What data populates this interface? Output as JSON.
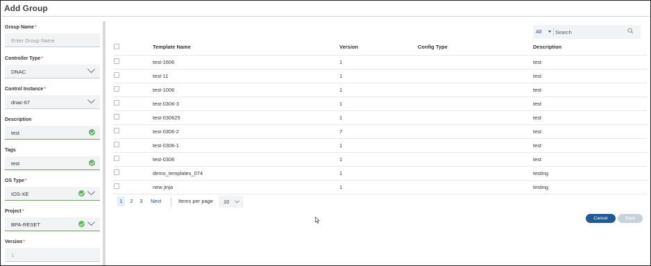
{
  "dialog": {
    "title": "Add Group"
  },
  "form": {
    "fields": [
      {
        "label": "Group Name",
        "required": true,
        "value": "",
        "placeholder": "Enter Group Name",
        "control": "text"
      },
      {
        "label": "Controller Type",
        "required": true,
        "value": "DNAC",
        "control": "select"
      },
      {
        "label": "Control Instance",
        "required": true,
        "value": "dnac-67",
        "control": "select"
      },
      {
        "label": "Description",
        "required": false,
        "value": "test",
        "control": "text",
        "valid": true
      },
      {
        "label": "Tags",
        "required": false,
        "value": "test",
        "control": "text",
        "valid": true
      },
      {
        "label": "OS Type",
        "required": true,
        "value": "IOS-XE",
        "control": "select",
        "valid": true
      },
      {
        "label": "Project",
        "required": true,
        "value": "BPA-RESET",
        "control": "select",
        "valid": true
      },
      {
        "label": "Version",
        "required": true,
        "value": "1",
        "control": "text",
        "disabled": true
      }
    ]
  },
  "filter": {
    "scope": "All",
    "search_placeholder": "Search",
    "search_value": ""
  },
  "table": {
    "columns": [
      "Template Name",
      "Version",
      "Config Type",
      "Description"
    ],
    "rows": [
      {
        "name": "test-1606",
        "version": "1",
        "config_type": "",
        "description": "test"
      },
      {
        "name": "test-11",
        "version": "1",
        "config_type": "",
        "description": "test"
      },
      {
        "name": "test-1006",
        "version": "1",
        "config_type": "",
        "description": "test"
      },
      {
        "name": "test-0306-3",
        "version": "1",
        "config_type": "",
        "description": "test"
      },
      {
        "name": "test-030625",
        "version": "1",
        "config_type": "",
        "description": "test"
      },
      {
        "name": "test-0306-2",
        "version": "7",
        "config_type": "",
        "description": "test"
      },
      {
        "name": "test-0306-1",
        "version": "1",
        "config_type": "",
        "description": "test"
      },
      {
        "name": "test-0306",
        "version": "1",
        "config_type": "",
        "description": "test"
      },
      {
        "name": "demo_templates_074",
        "version": "1",
        "config_type": "",
        "description": "testing"
      },
      {
        "name": "new jinja",
        "version": "1",
        "config_type": "",
        "description": "testing"
      }
    ]
  },
  "pagination": {
    "pages": [
      "1",
      "2",
      "3"
    ],
    "current": "1",
    "next_label": "Next",
    "items_per_page_label": "Items per page",
    "items_per_page": "10"
  },
  "actions": {
    "cancel_label": "Cancel",
    "save_label": "Save"
  },
  "colors": {
    "primary": "#1f5a96",
    "link": "#1f4e8a",
    "valid": "#5cb85c",
    "required": "#c0392b",
    "disabled_button": "#c8d2dc"
  }
}
